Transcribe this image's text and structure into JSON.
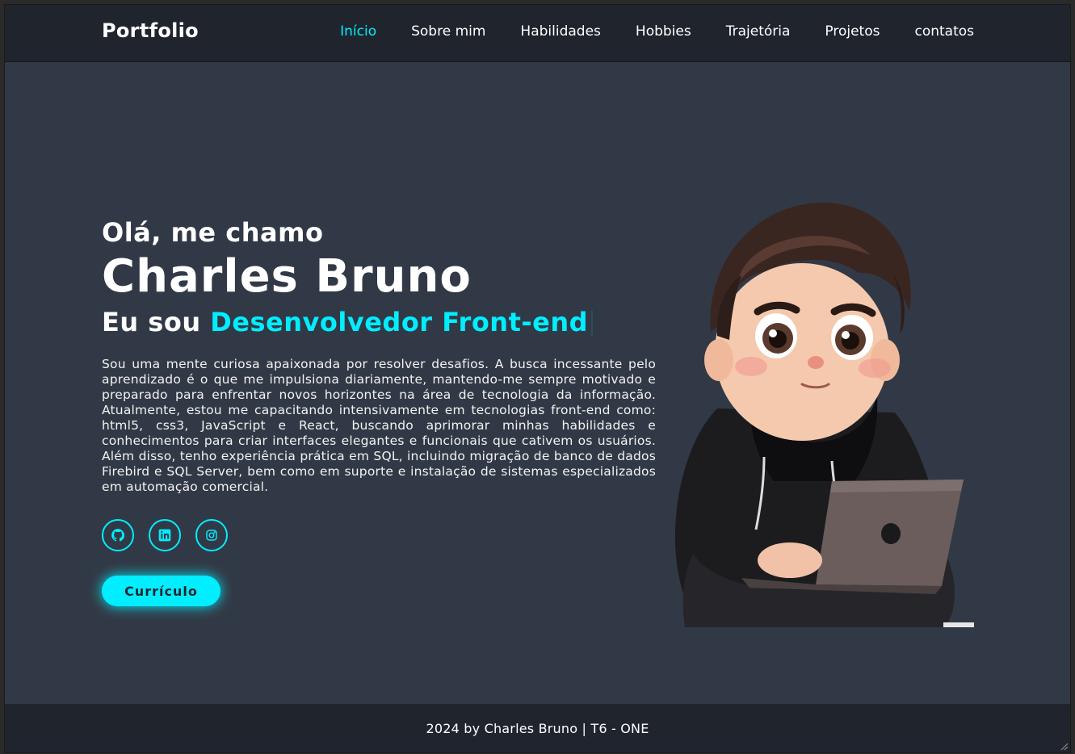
{
  "header": {
    "logo": "Portfolio",
    "nav": [
      {
        "label": "Início",
        "active": true
      },
      {
        "label": "Sobre mim"
      },
      {
        "label": "Habilidades"
      },
      {
        "label": "Hobbies"
      },
      {
        "label": "Trajetória"
      },
      {
        "label": "Projetos"
      },
      {
        "label": "contatos"
      }
    ]
  },
  "hero": {
    "greeting": "Olá, me chamo",
    "name": "Charles Bruno",
    "role_prefix": "Eu sou",
    "role_highlight": "Desenvolvedor Front-end",
    "bio": "Sou uma mente curiosa apaixonada por resolver desafios. A busca incessante pelo aprendizado é o que me impulsiona diariamente, mantendo-me sempre motivado e preparado para enfrentar novos horizontes na área de tecnologia da informação. Atualmente, estou me capacitando intensivamente em tecnologias front-end como: html5, css3, JavaScript e React, buscando aprimorar minhas habilidades e conhecimentos para criar interfaces elegantes e funcionais que cativem os usuários. Além disso, tenho experiência prática em SQL, incluindo migração de banco de dados Firebird e SQL Server, bem como em suporte e instalação de sistemas especializados em automação comercial.",
    "socials": [
      "github-icon",
      "linkedin-icon",
      "instagram-icon"
    ],
    "cv_button": "Currículo"
  },
  "footer": {
    "text": "2024 by Charles Bruno | T6 - ONE"
  },
  "colors": {
    "accent": "#00eeff",
    "bg": "#323946",
    "header_bg": "#1f242d"
  }
}
